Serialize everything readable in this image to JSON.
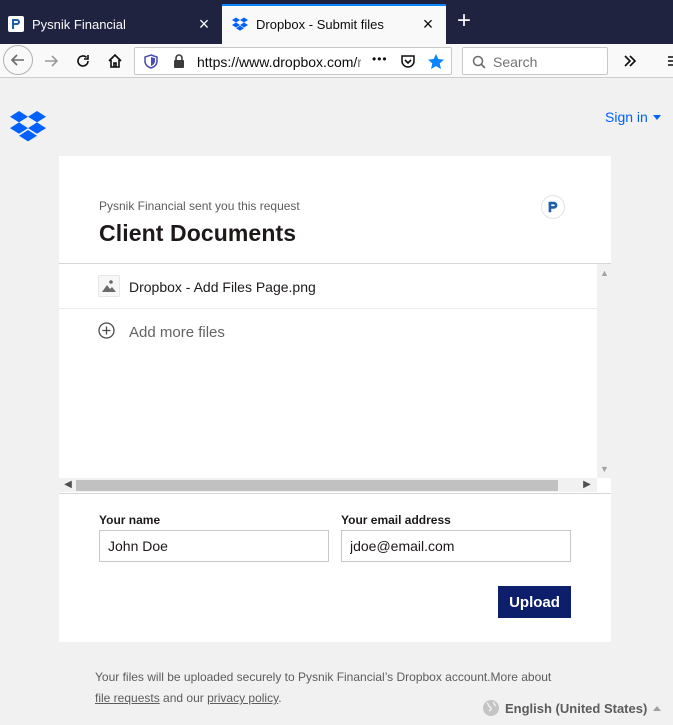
{
  "browser": {
    "tabs": [
      {
        "title": "Pysnik Financial",
        "active": false
      },
      {
        "title": "Dropbox - Submit files",
        "active": true
      }
    ],
    "url": {
      "host": "https://www.dropbox.com/",
      "rest": "r"
    },
    "search_placeholder": "Search",
    "menu_glyph": "•••"
  },
  "header": {
    "signin_label": "Sign in"
  },
  "request": {
    "sender_text": "Pysnik Financial sent you this request",
    "title": "Client Documents",
    "files": [
      {
        "name": "Dropbox - Add Files Page.png"
      }
    ],
    "add_more_label": "Add more files"
  },
  "form": {
    "name_label": "Your name",
    "name_value": "John Doe",
    "email_label": "Your email address",
    "email_value": "jdoe@email.com",
    "upload_label": "Upload"
  },
  "footer": {
    "text_before": "Your files will be uploaded securely to Pysnik Financial’s Dropbox account.More about ",
    "file_requests_link": "file requests",
    "text_middle": " and our ",
    "privacy_link": "privacy policy",
    "text_end": ".",
    "language": "English (United States)"
  },
  "colors": {
    "tabstrip_bg": "#202340",
    "accent_blue": "#0061fe",
    "upload_button": "#0d1f6b",
    "page_bg": "#f1f1f1"
  }
}
